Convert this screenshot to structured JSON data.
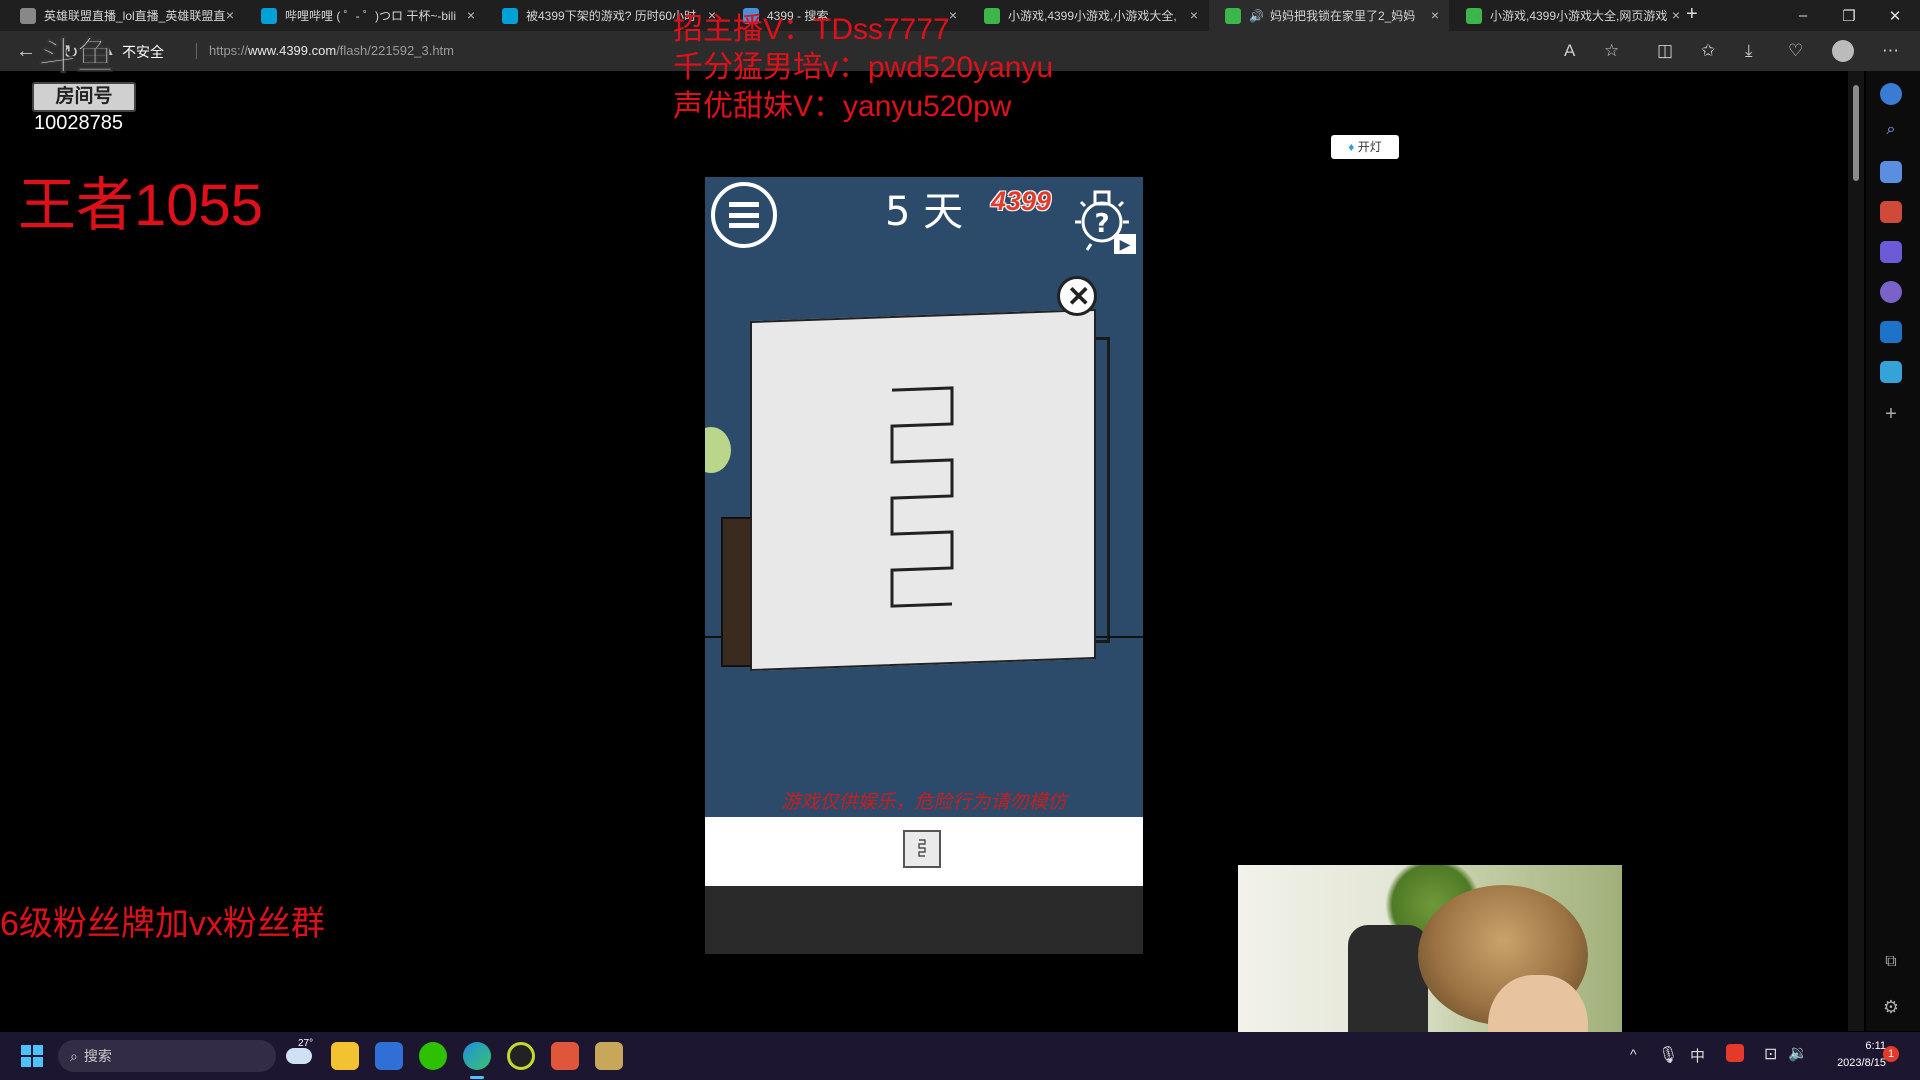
{
  "browser": {
    "tabs": [
      {
        "label": "英雄联盟直播_lol直播_英雄联盟直",
        "icon_color": "#888888",
        "active": false
      },
      {
        "label": "哔哩哔哩 ( ゜- ゜)つロ 干杯~-bili",
        "icon_color": "#00a1d6",
        "active": false
      },
      {
        "label": "被4399下架的游戏? 历时60小时",
        "icon_color": "#00a1d6",
        "active": false
      },
      {
        "label": "4399 - 搜索",
        "icon_color": "#4a90d9",
        "active": false
      },
      {
        "label": "小游戏,4399小游戏,小游戏大全,",
        "icon_color": "#3cb54a",
        "active": false
      },
      {
        "label": "妈妈把我锁在家里了2_妈妈",
        "icon_color": "#3cb54a",
        "active": true
      },
      {
        "label": "小游戏,4399小游戏大全,网页游戏",
        "icon_color": "#3cb54a",
        "active": false
      }
    ],
    "tab_close": "×",
    "new_tab": "+",
    "security_label": "不安全",
    "url_prefix": "https://",
    "url_host": "www.4399.com",
    "url_path": "/flash/221592_3.htm"
  },
  "stream_overlay": {
    "logo_text": "斗鱼",
    "room_label": "房间号",
    "room_number": "10028785",
    "rank_text": "王者1055",
    "contact_line1": "招主播V：TDss7777",
    "contact_line2": "千分猛男培v：pwd520yanyu",
    "contact_line3": "声优甜妹V：yanyu520pw",
    "fan_badge_text": "6级粉丝牌加vx粉丝群"
  },
  "game": {
    "day_counter": "5 天",
    "brand": "4399",
    "disclaimer": "游戏仅供娱乐，危险行为请勿模仿",
    "hint_play": "▶"
  },
  "light_toggle": {
    "label": "开灯"
  },
  "taskbar": {
    "search_placeholder": "搜索",
    "weather_temp": "27°",
    "ime": "中",
    "time": "6:11",
    "date": "2023/8/15",
    "notification_count": "1"
  },
  "colors": {
    "overlay_red": "#e0101a",
    "game_bg": "#2c4b6a",
    "paper": "#e8e8e8"
  }
}
